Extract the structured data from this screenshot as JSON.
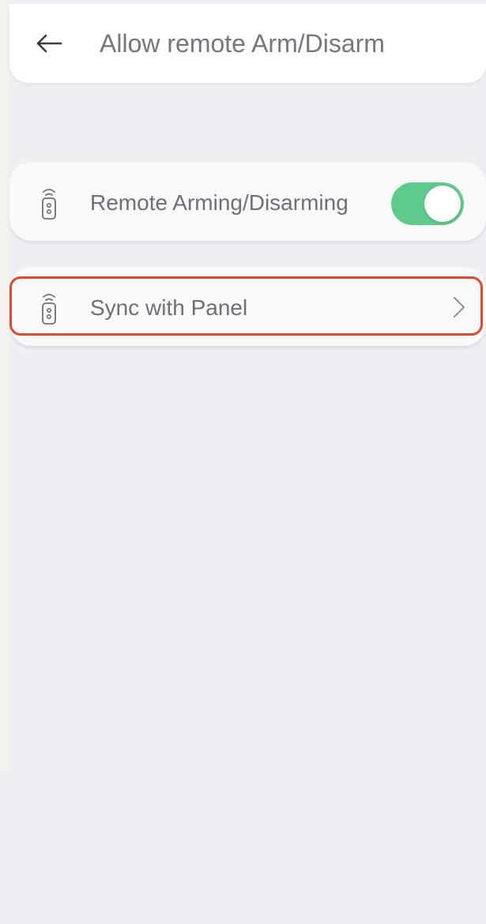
{
  "header": {
    "title": "Allow remote Arm/Disarm",
    "back_icon": "arrow-left-icon"
  },
  "settings": [
    {
      "icon": "remote-fob-icon",
      "label": "Remote Arming/Disarming",
      "control": "toggle",
      "toggle_on": true
    },
    {
      "icon": "remote-fob-icon",
      "label": "Sync with Panel",
      "control": "chevron",
      "chevron_icon": "chevron-right-icon"
    }
  ],
  "colors": {
    "background": "#efeef3",
    "card": "#f9f9f9",
    "toggle_on": "#5fcb8a",
    "text": "#6f6f78",
    "highlight": "#e04a2a"
  }
}
